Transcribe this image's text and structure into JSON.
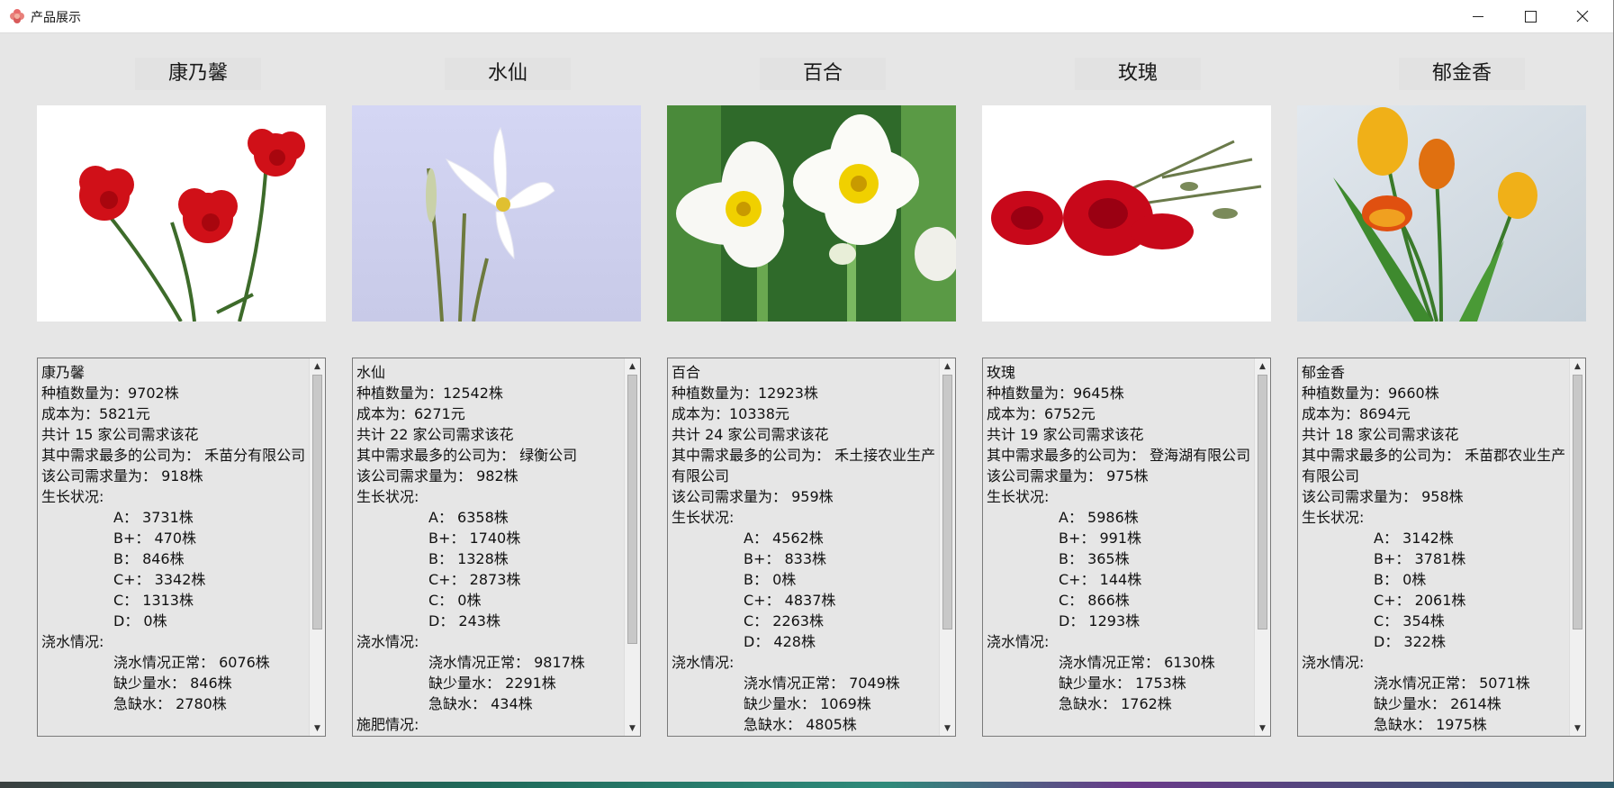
{
  "window": {
    "title": "产品展示"
  },
  "colors": {
    "titlebar": "#ffffff",
    "window_bg": "#e6e6e6",
    "border": "#7a7a7a"
  },
  "flowers": [
    {
      "id": "carnation",
      "name": "康乃馨",
      "lines": [
        {
          "text": "康乃馨",
          "indent": false
        },
        {
          "text": "种植数量为：9702株",
          "indent": false
        },
        {
          "text": "成本为：5821元",
          "indent": false
        },
        {
          "text": "共计 15 家公司需求该花",
          "indent": false
        },
        {
          "text": "其中需求最多的公司为： 禾苗分有限公司",
          "indent": false
        },
        {
          "text": "该公司需求量为： 918株",
          "indent": false
        },
        {
          "text": "生长状况:",
          "indent": false
        },
        {
          "text": "A： 3731株",
          "indent": true
        },
        {
          "text": "B+： 470株",
          "indent": true
        },
        {
          "text": "B： 846株",
          "indent": true
        },
        {
          "text": "C+： 3342株",
          "indent": true
        },
        {
          "text": "C： 1313株",
          "indent": true
        },
        {
          "text": "D： 0株",
          "indent": true
        },
        {
          "text": "浇水情况:",
          "indent": false
        },
        {
          "text": "浇水情况正常： 6076株",
          "indent": true
        },
        {
          "text": "缺少量水： 846株",
          "indent": true
        },
        {
          "text": "急缺水： 2780株",
          "indent": true
        }
      ],
      "scroll_fraction": 0.74
    },
    {
      "id": "narcissus",
      "name": "水仙",
      "lines": [
        {
          "text": "水仙",
          "indent": false
        },
        {
          "text": "种植数量为：12542株",
          "indent": false
        },
        {
          "text": "成本为：6271元",
          "indent": false
        },
        {
          "text": "共计 22 家公司需求该花",
          "indent": false
        },
        {
          "text": "其中需求最多的公司为： 绿衡公司",
          "indent": false
        },
        {
          "text": "该公司需求量为： 982株",
          "indent": false
        },
        {
          "text": "生长状况:",
          "indent": false
        },
        {
          "text": "A： 6358株",
          "indent": true
        },
        {
          "text": "B+： 1740株",
          "indent": true
        },
        {
          "text": "B： 1328株",
          "indent": true
        },
        {
          "text": "C+： 2873株",
          "indent": true
        },
        {
          "text": "C： 0株",
          "indent": true
        },
        {
          "text": "D： 243株",
          "indent": true
        },
        {
          "text": "浇水情况:",
          "indent": false
        },
        {
          "text": "浇水情况正常： 9817株",
          "indent": true
        },
        {
          "text": "缺少量水： 2291株",
          "indent": true
        },
        {
          "text": "急缺水： 434株",
          "indent": true
        },
        {
          "text": "施肥情况:",
          "indent": false
        }
      ],
      "scroll_fraction": 0.78
    },
    {
      "id": "lily",
      "name": "百合",
      "lines": [
        {
          "text": "百合",
          "indent": false
        },
        {
          "text": "种植数量为：12923株",
          "indent": false
        },
        {
          "text": "成本为：10338元",
          "indent": false
        },
        {
          "text": "共计 24 家公司需求该花",
          "indent": false
        },
        {
          "text": "其中需求最多的公司为： 禾土接农业生产有限公司",
          "indent": false
        },
        {
          "text": "该公司需求量为： 959株",
          "indent": false
        },
        {
          "text": "生长状况:",
          "indent": false
        },
        {
          "text": "A： 4562株",
          "indent": true
        },
        {
          "text": "B+： 833株",
          "indent": true
        },
        {
          "text": "B： 0株",
          "indent": true
        },
        {
          "text": "C+： 4837株",
          "indent": true
        },
        {
          "text": "C： 2263株",
          "indent": true
        },
        {
          "text": "D： 428株",
          "indent": true
        },
        {
          "text": "浇水情况:",
          "indent": false
        },
        {
          "text": "浇水情况正常： 7049株",
          "indent": true
        },
        {
          "text": "缺少量水： 1069株",
          "indent": true
        },
        {
          "text": "急缺水： 4805株",
          "indent": true
        }
      ],
      "scroll_fraction": 0.74
    },
    {
      "id": "rose",
      "name": "玫瑰",
      "lines": [
        {
          "text": "玫瑰",
          "indent": false
        },
        {
          "text": "种植数量为：9645株",
          "indent": false
        },
        {
          "text": "成本为：6752元",
          "indent": false
        },
        {
          "text": "共计 19 家公司需求该花",
          "indent": false
        },
        {
          "text": "其中需求最多的公司为： 登海湖有限公司",
          "indent": false
        },
        {
          "text": "该公司需求量为： 975株",
          "indent": false
        },
        {
          "text": "生长状况:",
          "indent": false
        },
        {
          "text": "A： 5986株",
          "indent": true
        },
        {
          "text": "B+： 991株",
          "indent": true
        },
        {
          "text": "B： 365株",
          "indent": true
        },
        {
          "text": "C+： 144株",
          "indent": true
        },
        {
          "text": "C： 866株",
          "indent": true
        },
        {
          "text": "D： 1293株",
          "indent": true
        },
        {
          "text": "浇水情况:",
          "indent": false
        },
        {
          "text": "浇水情况正常： 6130株",
          "indent": true
        },
        {
          "text": "缺少量水： 1753株",
          "indent": true
        },
        {
          "text": "急缺水： 1762株",
          "indent": true
        }
      ],
      "scroll_fraction": 0.74
    },
    {
      "id": "tulip",
      "name": "郁金香",
      "lines": [
        {
          "text": "郁金香",
          "indent": false
        },
        {
          "text": "种植数量为：9660株",
          "indent": false
        },
        {
          "text": "成本为：8694元",
          "indent": false
        },
        {
          "text": "共计 18 家公司需求该花",
          "indent": false
        },
        {
          "text": "其中需求最多的公司为： 禾苗郡农业生产有限公司",
          "indent": false
        },
        {
          "text": "该公司需求量为： 958株",
          "indent": false
        },
        {
          "text": "生长状况:",
          "indent": false
        },
        {
          "text": "A： 3142株",
          "indent": true
        },
        {
          "text": "B+： 3781株",
          "indent": true
        },
        {
          "text": "B： 0株",
          "indent": true
        },
        {
          "text": "C+： 2061株",
          "indent": true
        },
        {
          "text": "C： 354株",
          "indent": true
        },
        {
          "text": "D： 322株",
          "indent": true
        },
        {
          "text": "浇水情况:",
          "indent": false
        },
        {
          "text": "浇水情况正常： 5071株",
          "indent": true
        },
        {
          "text": "缺少量水： 2614株",
          "indent": true
        },
        {
          "text": "急缺水： 1975株",
          "indent": true
        }
      ],
      "scroll_fraction": 0.74
    }
  ]
}
